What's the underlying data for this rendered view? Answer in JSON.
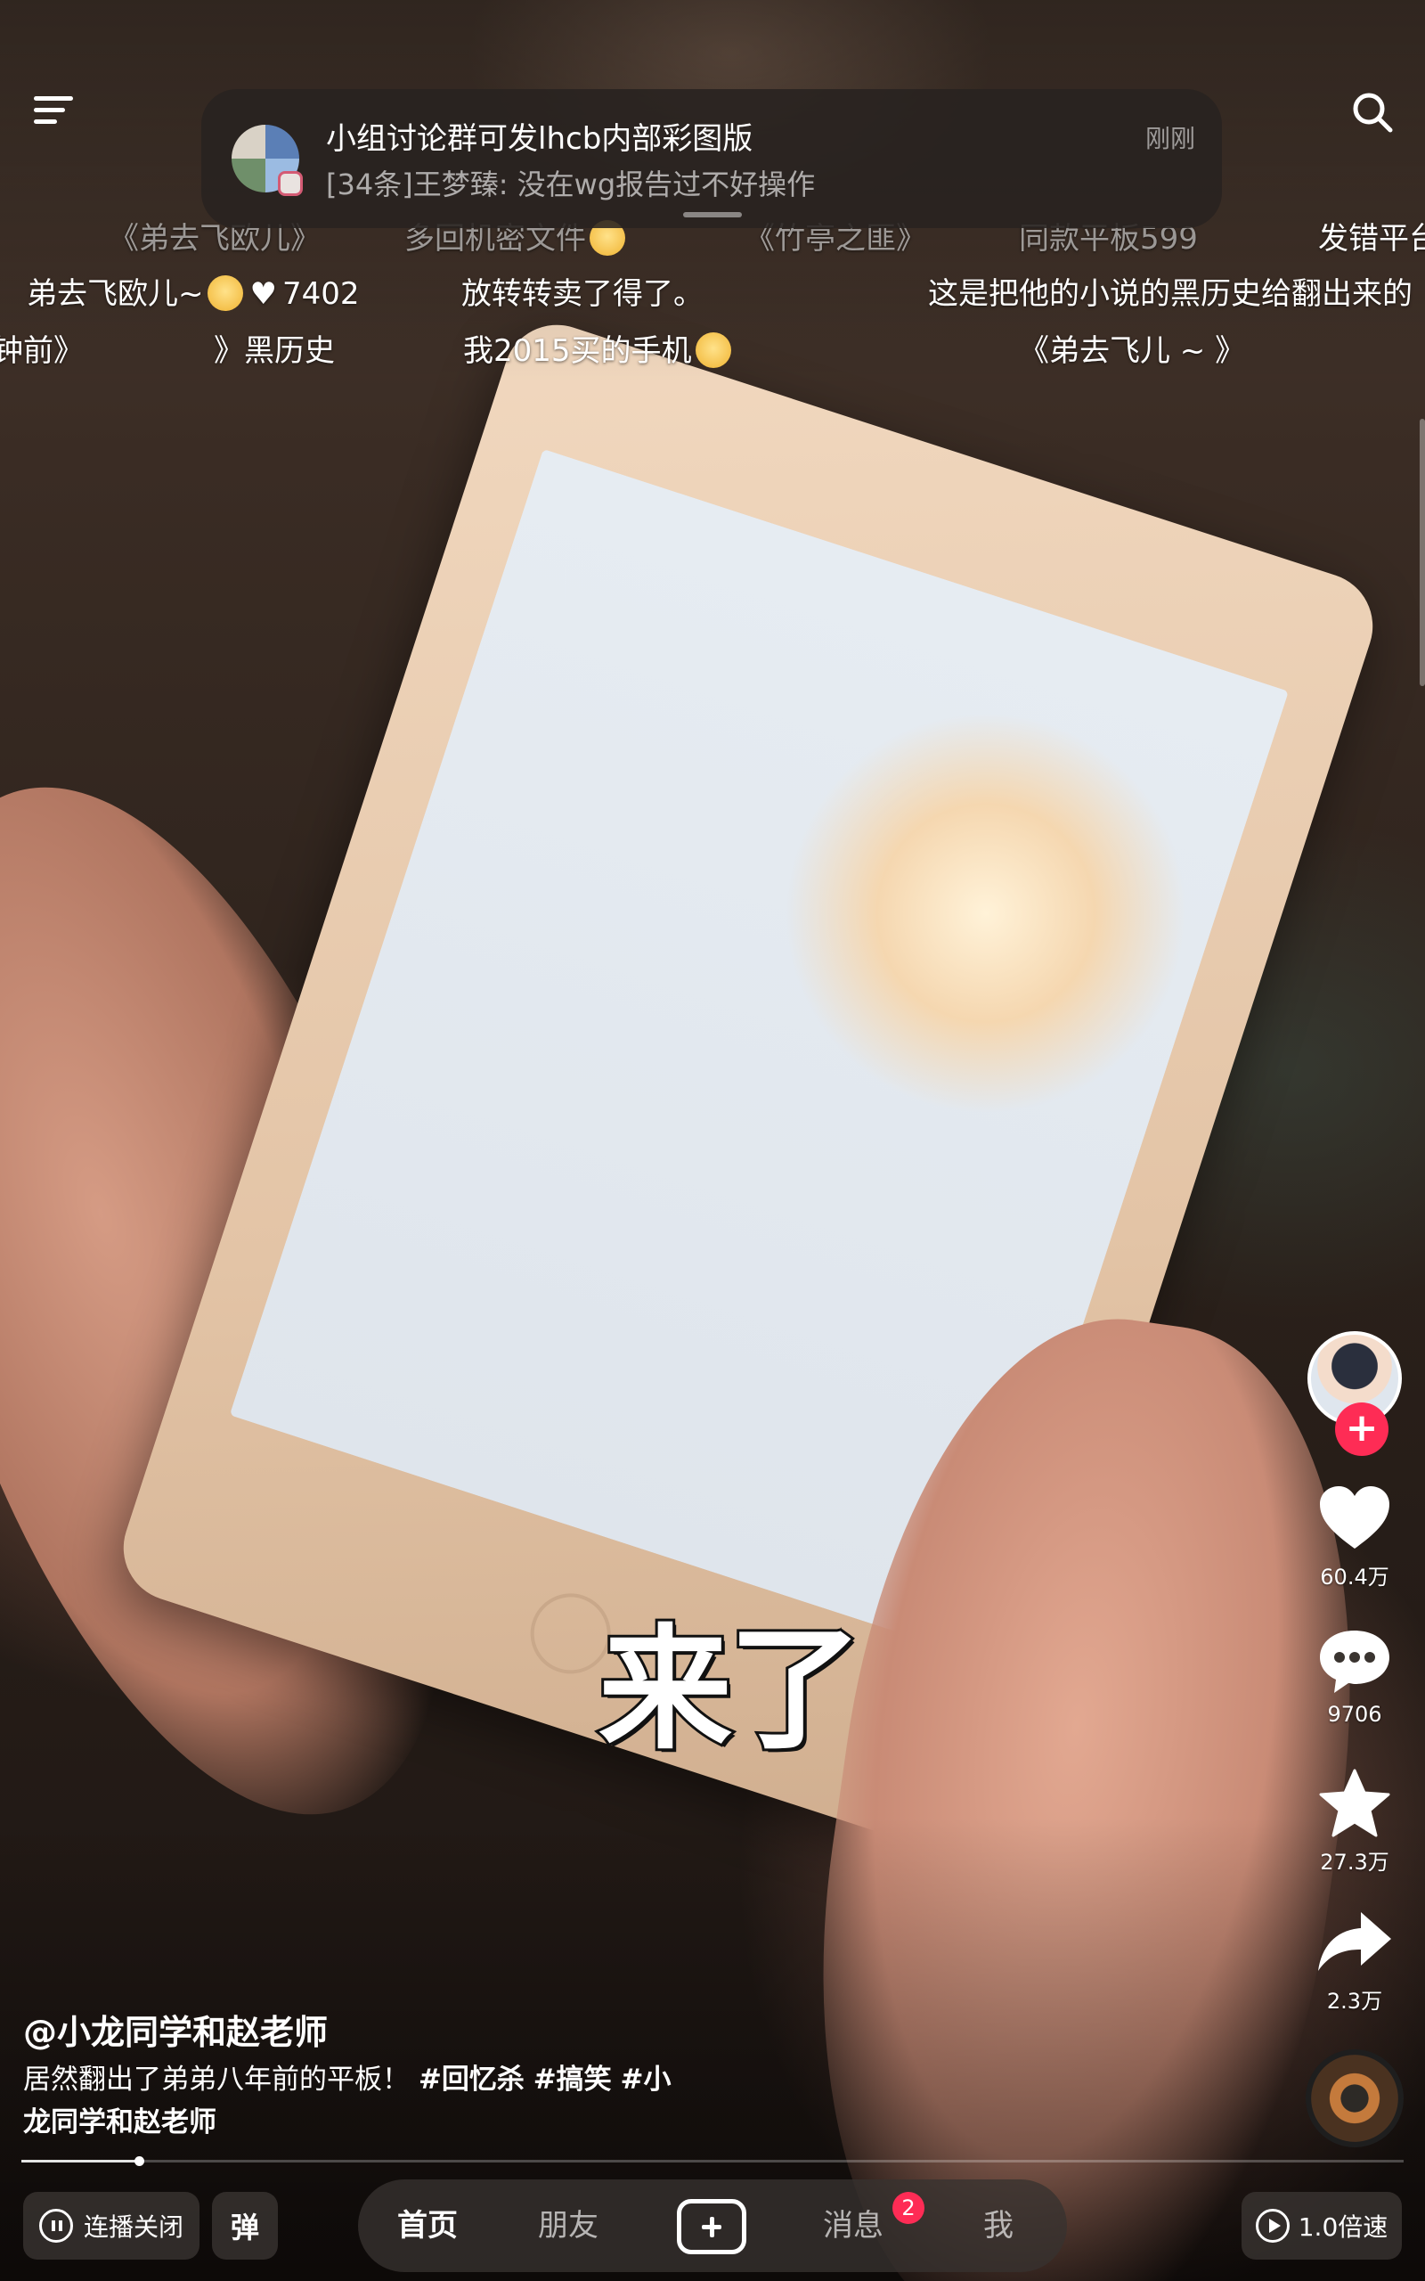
{
  "notification": {
    "title": "小组讨论群可发lhcb内部彩图版",
    "body": "[34条]王梦臻: 没在wg报告过不好操作",
    "time": "刚刚"
  },
  "danmaku": {
    "row1": [
      "《弟去飞欧儿》",
      "多回机密文件",
      "《竹亭之匪》",
      "同款平板599",
      "发错平台"
    ],
    "row2": {
      "text1": "弟去飞欧儿~",
      "likes": "7402",
      "text2": "放转转卖了得了。",
      "text3": "这是把他的小说的黑历史给翻出来的"
    },
    "row3": [
      "钟前》",
      "》黑历史",
      "我2015买的手机",
      "《弟去飞儿 ~ 》"
    ]
  },
  "subtitle": "来了",
  "rail": {
    "likes": "60.4万",
    "comments": "9706",
    "favorites": "27.3万",
    "shares": "2.3万",
    "follow_symbol": "+"
  },
  "post": {
    "author": "@小龙同学和赵老师",
    "caption_text": "居然翻出了弟弟八年前的平板！",
    "tags": [
      "#回忆杀",
      "#搞笑",
      "#小龙同学和赵老师"
    ]
  },
  "progress": {
    "fraction": 0.085
  },
  "bottom": {
    "autoplay_label": "连播关闭",
    "danmu_label": "弹",
    "nav": {
      "home": "首页",
      "friends": "朋友",
      "messages": "消息",
      "messages_badge": "2",
      "me": "我"
    },
    "speed_label": "1.0倍速"
  },
  "colors": {
    "accent": "#fe2c55"
  }
}
